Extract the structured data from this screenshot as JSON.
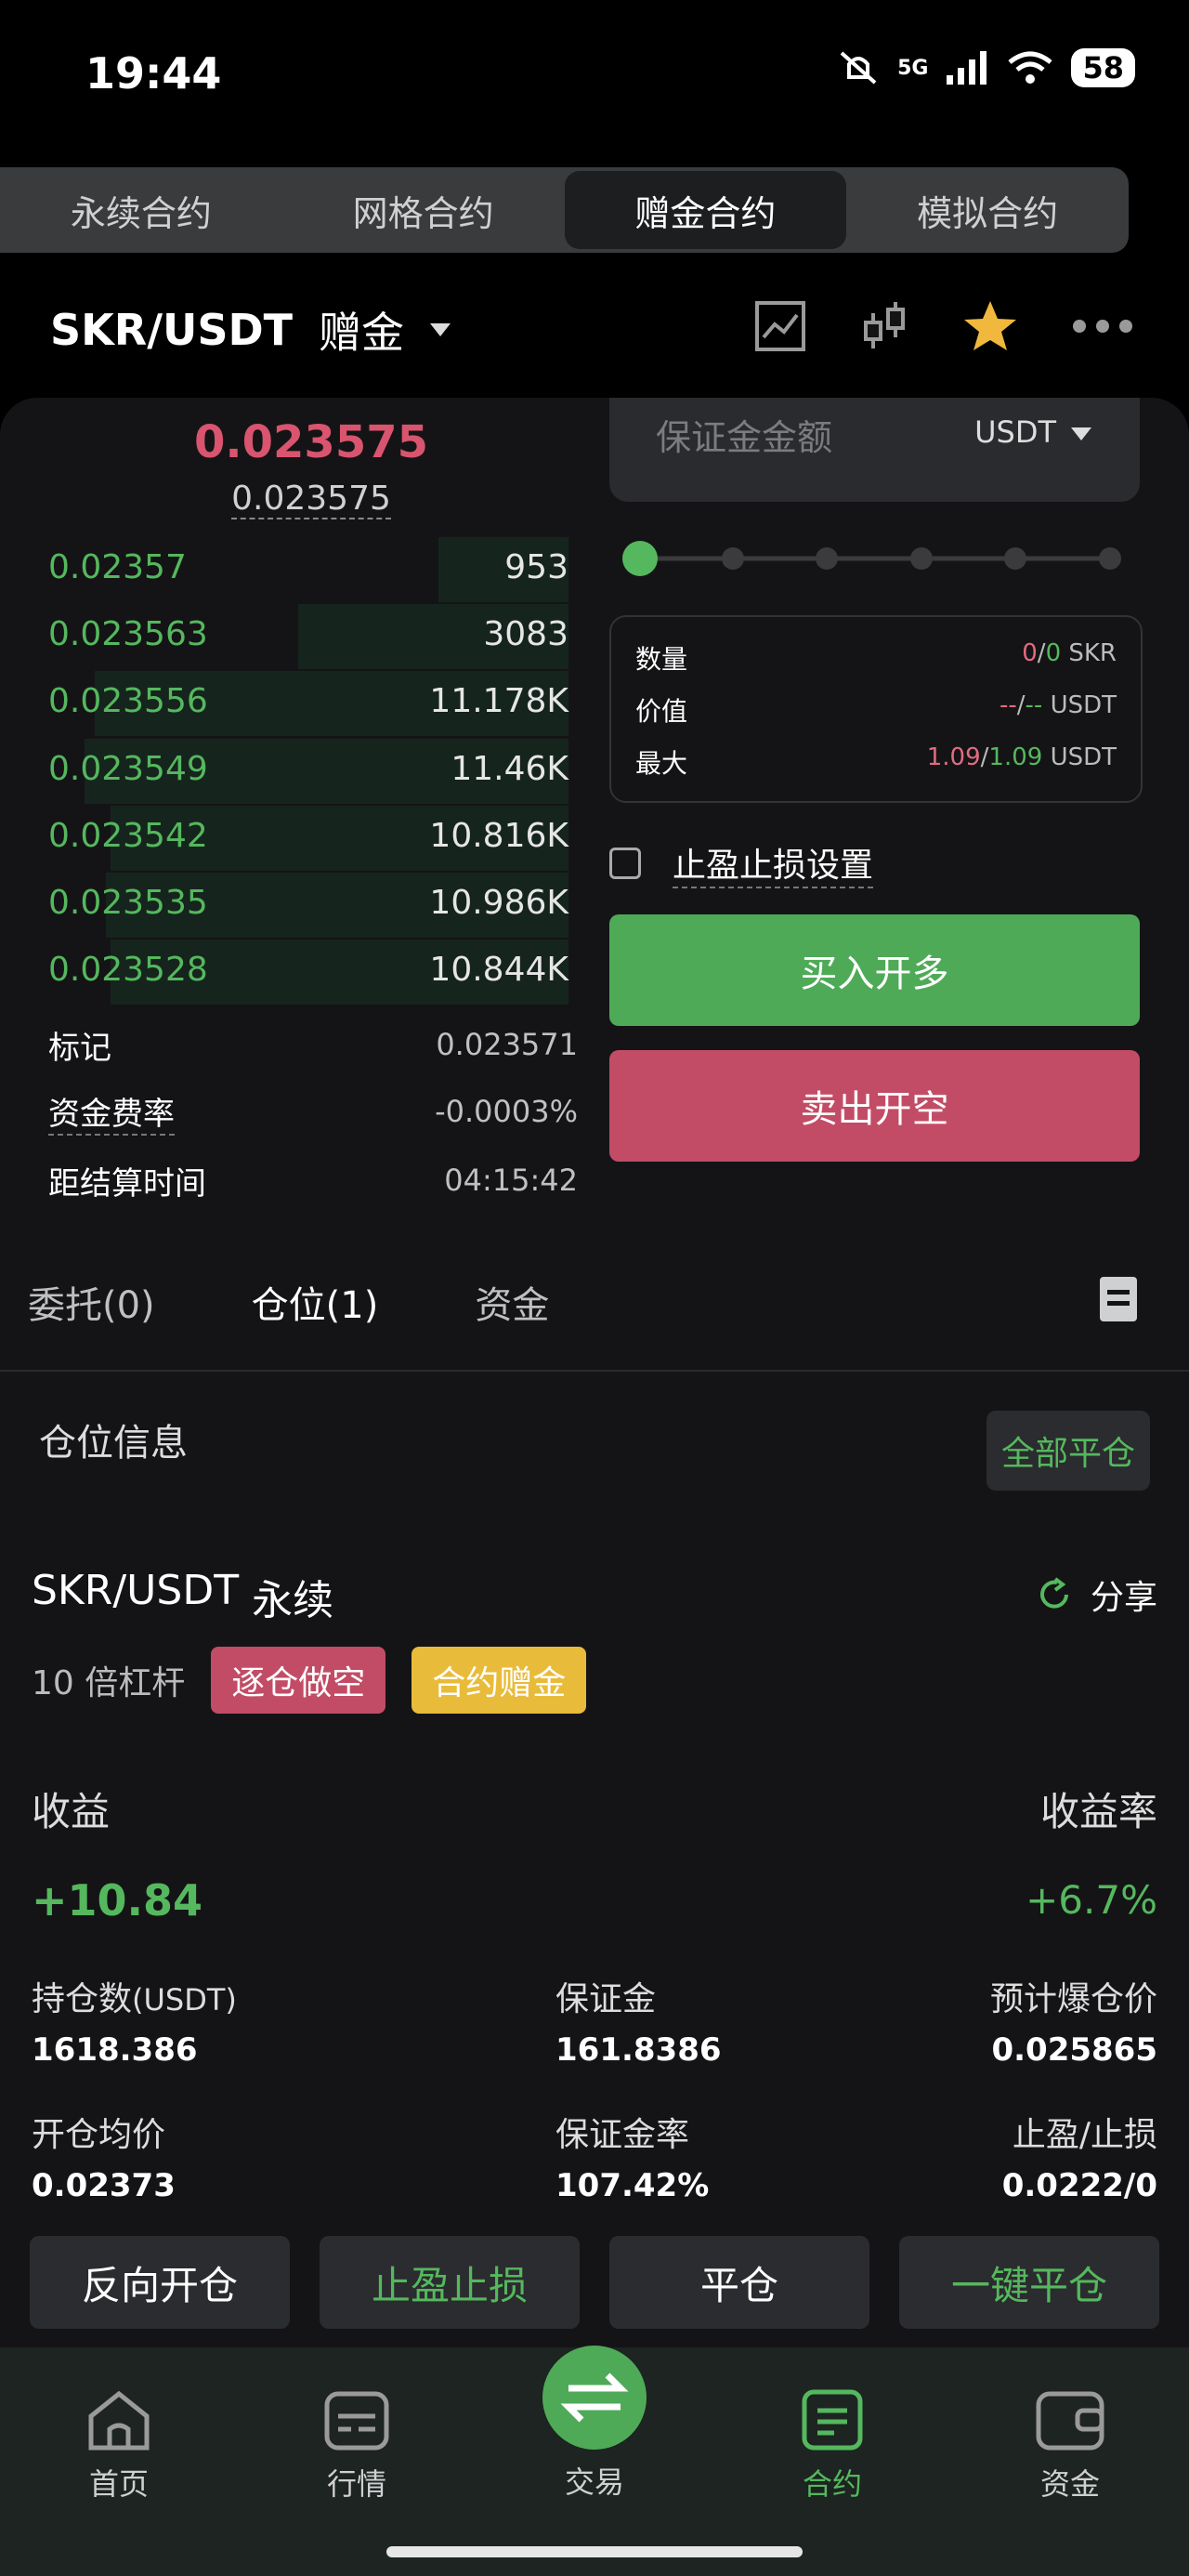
{
  "status": {
    "time": "19:44",
    "battery": "58",
    "network": "5G"
  },
  "tabs": [
    {
      "label": "永续合约"
    },
    {
      "label": "网格合约"
    },
    {
      "label": "赠金合约"
    },
    {
      "label": "模拟合约"
    }
  ],
  "header": {
    "pair": "SKR/USDT",
    "mode": "赠金"
  },
  "price": {
    "last": "0.023575",
    "mark": "0.023575"
  },
  "orderbook": [
    {
      "price": "0.02357",
      "qty": "953",
      "depth": 0.25
    },
    {
      "price": "0.023563",
      "qty": "3083",
      "depth": 0.52
    },
    {
      "price": "0.023556",
      "qty": "11.178K",
      "depth": 0.91
    },
    {
      "price": "0.023549",
      "qty": "11.46K",
      "depth": 0.93
    },
    {
      "price": "0.023542",
      "qty": "10.816K",
      "depth": 0.88
    },
    {
      "price": "0.023535",
      "qty": "10.986K",
      "depth": 0.89
    },
    {
      "price": "0.023528",
      "qty": "10.844K",
      "depth": 0.88
    }
  ],
  "market_info": {
    "mark_label": "标记",
    "mark_value": "0.023571",
    "funding_label": "资金费率",
    "funding_value": "-0.0003%",
    "settle_label": "距结算时间",
    "settle_value": "04:15:42"
  },
  "order_form": {
    "margin_placeholder": "保证金金额",
    "currency": "USDT",
    "qty_label": "数量",
    "qty_a": "0",
    "qty_sep": "/",
    "qty_b": "0",
    "qty_unit": "SKR",
    "value_label": "价值",
    "value_a": "--",
    "value_b": "--",
    "value_unit": "USDT",
    "max_label": "最大",
    "max_a": "1.09",
    "max_b": "1.09",
    "max_unit": "USDT",
    "tpsl_label": "止盈止损设置",
    "buy_label": "买入开多",
    "sell_label": "卖出开空"
  },
  "sub_tabs": {
    "orders": "委托(0)",
    "positions": "仓位(1)",
    "funds": "资金"
  },
  "position_header": {
    "title": "仓位信息",
    "close_all": "全部平仓"
  },
  "position": {
    "pair": "SKR/USDT",
    "type": "永续",
    "share": "分享",
    "leverage": "10 倍杠杆",
    "tag_side": "逐仓做空",
    "tag_bonus": "合约赠金",
    "pnl_label": "收益",
    "pnl_value": "+10.84",
    "roe_label": "收益率",
    "roe_value": "+6.7%",
    "size_label": "持仓数",
    "size_unit": "(USDT)",
    "size_value": "1618.386",
    "margin_label": "保证金",
    "margin_value": "161.8386",
    "liq_label": "预计爆仓价",
    "liq_value": "0.025865",
    "entry_label": "开仓均价",
    "entry_value": "0.02373",
    "margin_ratio_label": "保证金率",
    "margin_ratio_value": "107.42%",
    "tpsl_label": "止盈/止损",
    "tpsl_value": "0.0222/0"
  },
  "position_actions": {
    "reverse": "反向开仓",
    "tpsl": "止盈止损",
    "close": "平仓",
    "quick_close": "一键平仓"
  },
  "bottom_nav": {
    "home": "首页",
    "market": "行情",
    "trade": "交易",
    "contract": "合约",
    "assets": "资金"
  },
  "colors": {
    "green": "#55b85e",
    "red": "#d9546e",
    "buy": "#4faa58",
    "sell": "#c24c66",
    "yellow": "#e9bb3a"
  }
}
